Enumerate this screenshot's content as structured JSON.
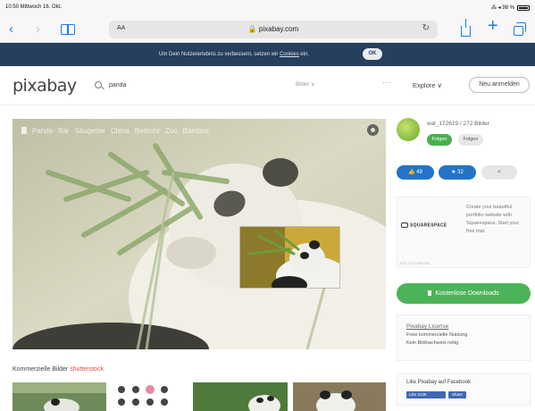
{
  "status_bar": {
    "time": "10:50  Mittwoch 16. Okt.",
    "right": "⁂ ◂ 98 %"
  },
  "browser": {
    "aa_label": "AA",
    "url": "🔒 pixabay.com",
    "reload_icon": "reload-icon",
    "back_glyph": "‹",
    "forward_glyph": "›",
    "plus_glyph": "+"
  },
  "cookie_banner": {
    "text": "Um Dein Nutzererlebnis zu verbessern, setzen wir ",
    "link": "Cookies",
    "text_end": " ein.",
    "ok_label": "OK"
  },
  "header": {
    "logo": "pixabay",
    "search_value": "panda",
    "search_type": "Bilder ∨",
    "more": "···",
    "explore": "Explore ∨",
    "signup": "Neu anmelden"
  },
  "image": {
    "tags": [
      "Panda",
      "Bär",
      "Säugetier",
      "China",
      "Bedroht",
      "Zoo",
      "Bambus"
    ]
  },
  "commercial": {
    "label": "Kommerzielle Bilder",
    "sponsor": "shutterstock"
  },
  "author": {
    "name": "wal_172619 / 272 Bilder",
    "follow_label": "Folgen",
    "second_label": "Folgen"
  },
  "actions": {
    "likes": "👍 49",
    "favorites": "★ 32",
    "share": "<"
  },
  "ad": {
    "brand": "SQUARESPACE",
    "text": "Create your beautiful portfolio website with Squarespace. Start your free trial.",
    "footer": "ADS VIA CARBON"
  },
  "download": {
    "label": "Kostenlose Downloads"
  },
  "license": {
    "title": "Pixabay License",
    "line1": "Freie kommerzielle Nutzung",
    "line2": "Kein Bildnachweis nötig"
  },
  "facebook": {
    "title": "Like Pixabay auf Facebook",
    "like": "Like 313K",
    "share": "Share"
  },
  "colors": {
    "brand_green": "#4db35a",
    "cookie_bg": "#253f5c",
    "action_blue": "#2374c9",
    "ios_blue": "#1a7cf5"
  }
}
